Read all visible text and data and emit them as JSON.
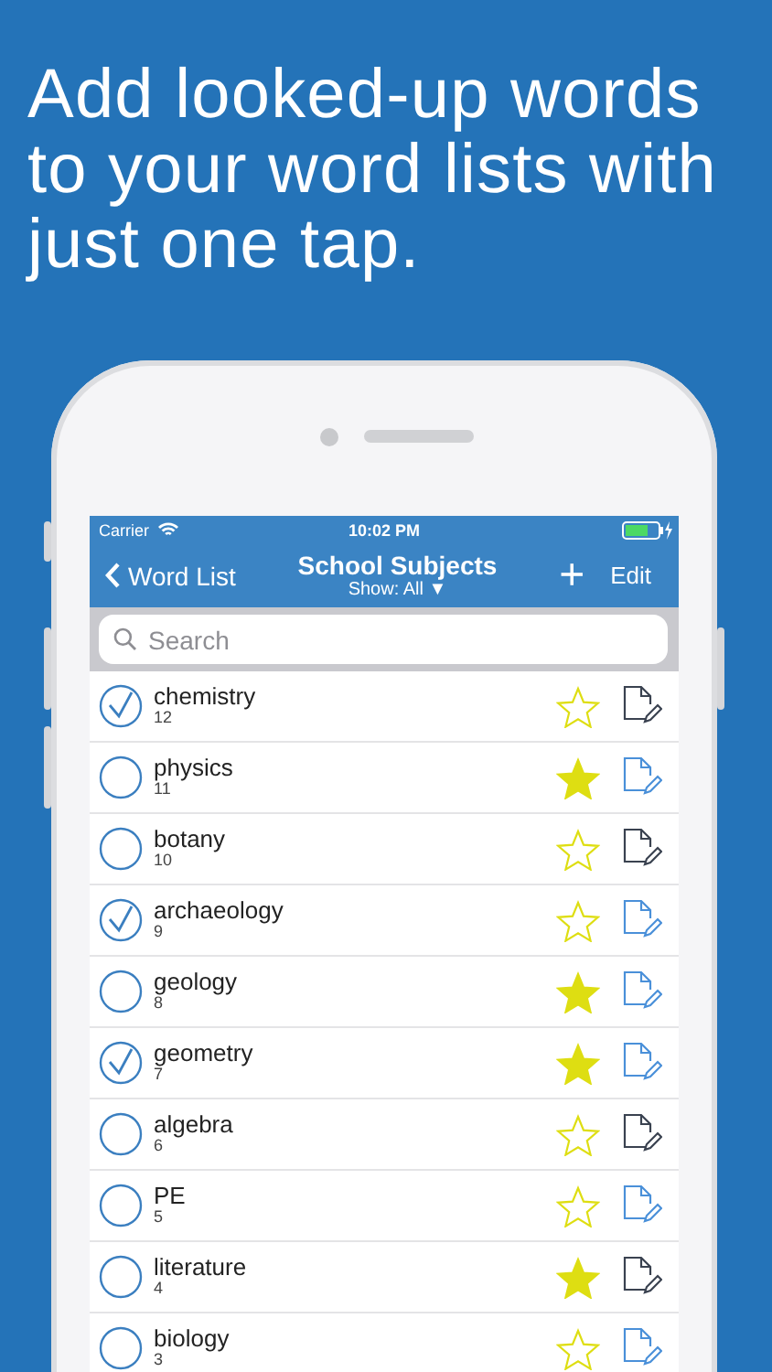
{
  "headline": "Add looked-up words to your word lists with just one tap.",
  "status_bar": {
    "carrier": "Carrier",
    "time": "10:02 PM"
  },
  "nav": {
    "back": "Word List",
    "title": "School Subjects",
    "filter": "Show: All ▼",
    "add": "+",
    "edit": "Edit"
  },
  "search": {
    "placeholder": "Search"
  },
  "lists": [
    {
      "name": "chemistry",
      "count": "12",
      "checked": true,
      "favorite": false,
      "has_note": true
    },
    {
      "name": "physics",
      "count": "11",
      "checked": false,
      "favorite": true,
      "has_note": false
    },
    {
      "name": "botany",
      "count": "10",
      "checked": false,
      "favorite": false,
      "has_note": true
    },
    {
      "name": "archaeology",
      "count": "9",
      "checked": true,
      "favorite": false,
      "has_note": false
    },
    {
      "name": "geology",
      "count": "8",
      "checked": false,
      "favorite": true,
      "has_note": false
    },
    {
      "name": "geometry",
      "count": "7",
      "checked": true,
      "favorite": true,
      "has_note": false
    },
    {
      "name": "algebra",
      "count": "6",
      "checked": false,
      "favorite": false,
      "has_note": true
    },
    {
      "name": "PE",
      "count": "5",
      "checked": false,
      "favorite": false,
      "has_note": false
    },
    {
      "name": "literature",
      "count": "4",
      "checked": false,
      "favorite": true,
      "has_note": true
    },
    {
      "name": "biology",
      "count": "3",
      "checked": false,
      "favorite": false,
      "has_note": false
    }
  ]
}
